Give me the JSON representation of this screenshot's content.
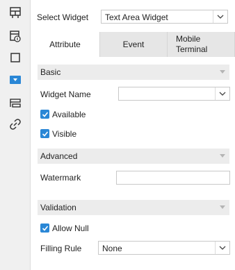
{
  "sidebar": {
    "icons": [
      "grid-layout-icon",
      "widget-settings-icon",
      "frame-icon",
      "dropdown-widget-icon",
      "layers-icon",
      "link-icon"
    ],
    "active_index": 3,
    "accent": "#2a87d6"
  },
  "select_widget": {
    "label": "Select Widget",
    "value": "Text Area Widget"
  },
  "tabs": [
    {
      "label": "Attribute",
      "active": true
    },
    {
      "label": "Event",
      "active": false
    },
    {
      "label": "Mobile Terminal",
      "active": false
    }
  ],
  "basic": {
    "title": "Basic",
    "widget_name_label": "Widget Name",
    "widget_name_value": "",
    "available_label": "Available",
    "available_checked": true,
    "visible_label": "Visible",
    "visible_checked": true
  },
  "advanced": {
    "title": "Advanced",
    "watermark_label": "Watermark",
    "watermark_value": ""
  },
  "validation": {
    "title": "Validation",
    "allow_null_label": "Allow Null",
    "allow_null_checked": true,
    "filling_rule_label": "Filling Rule",
    "filling_rule_value": "None"
  }
}
